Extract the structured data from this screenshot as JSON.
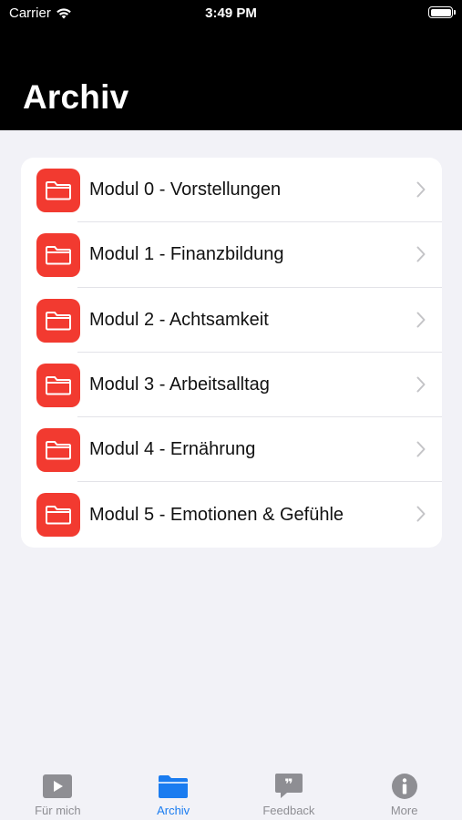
{
  "status_bar": {
    "carrier": "Carrier",
    "time": "3:49 PM"
  },
  "header": {
    "title": "Archiv"
  },
  "modules": [
    {
      "label": "Modul 0 - Vorstellungen"
    },
    {
      "label": "Modul 1 - Finanzbildung"
    },
    {
      "label": "Modul 2 - Achtsamkeit"
    },
    {
      "label": "Modul 3 - Arbeitsalltag"
    },
    {
      "label": "Modul 4 - Ernährung"
    },
    {
      "label": "Modul 5 - Emotionen & Gefühle"
    }
  ],
  "tabs": [
    {
      "label": "Für mich",
      "icon": "play-icon"
    },
    {
      "label": "Archiv",
      "icon": "folder-icon",
      "active": true
    },
    {
      "label": "Feedback",
      "icon": "quote-bubble-icon"
    },
    {
      "label": "More",
      "icon": "info-icon"
    }
  ],
  "colors": {
    "folder": "#f23a30",
    "accent": "#1a7cf0",
    "inactive": "#8e8e93"
  }
}
